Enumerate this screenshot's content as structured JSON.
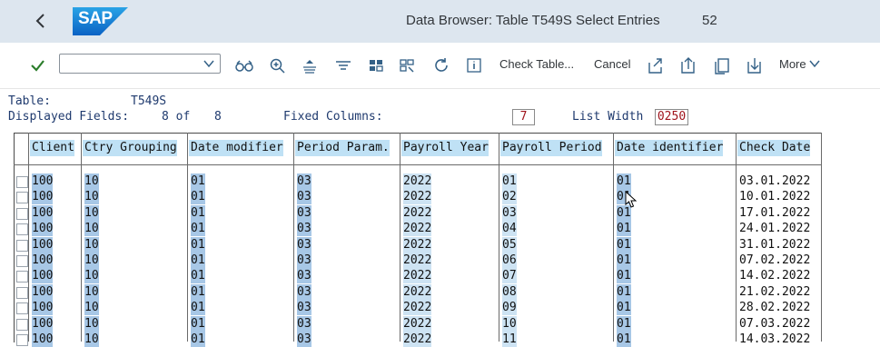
{
  "header": {
    "title": "Data Browser: Table T549S Select Entries",
    "count": "52",
    "logo": "SAP"
  },
  "toolbar": {
    "command_value": "",
    "check_table": "Check Table...",
    "cancel": "Cancel",
    "more": "More"
  },
  "info": {
    "table_label": "Table:",
    "table_name": "T549S",
    "displayed_label": "Displayed Fields:",
    "displayed_value": "8 of",
    "displayed_total": "8",
    "fixed_label": "Fixed Columns:",
    "fixed_value": "7",
    "list_width_label": "List Width",
    "list_width_value": "0250"
  },
  "columns": [
    "Client",
    "Ctry Grouping",
    "Date modifier",
    "Period Param.",
    "Payroll Year",
    "Payroll Period",
    "Date identifier",
    "Check Date"
  ],
  "rows": [
    [
      "100",
      "10",
      "01",
      "03",
      "2022",
      "01",
      "01",
      "03.01.2022"
    ],
    [
      "100",
      "10",
      "01",
      "03",
      "2022",
      "02",
      "01",
      "10.01.2022"
    ],
    [
      "100",
      "10",
      "01",
      "03",
      "2022",
      "03",
      "01",
      "17.01.2022"
    ],
    [
      "100",
      "10",
      "01",
      "03",
      "2022",
      "04",
      "01",
      "24.01.2022"
    ],
    [
      "100",
      "10",
      "01",
      "03",
      "2022",
      "05",
      "01",
      "31.01.2022"
    ],
    [
      "100",
      "10",
      "01",
      "03",
      "2022",
      "06",
      "01",
      "07.02.2022"
    ],
    [
      "100",
      "10",
      "01",
      "03",
      "2022",
      "07",
      "01",
      "14.02.2022"
    ],
    [
      "100",
      "10",
      "01",
      "03",
      "2022",
      "08",
      "01",
      "21.02.2022"
    ],
    [
      "100",
      "10",
      "01",
      "03",
      "2022",
      "09",
      "01",
      "28.02.2022"
    ],
    [
      "100",
      "10",
      "01",
      "03",
      "2022",
      "10",
      "01",
      "07.03.2022"
    ],
    [
      "100",
      "10",
      "01",
      "03",
      "2022",
      "11",
      "01",
      "14.03.2022"
    ]
  ],
  "colors": {
    "accent": "#346187",
    "brand": "#1a76c7",
    "header_bg": "#dde6ef",
    "col_highlight": "#a7c7e6",
    "warning_text": "#a0141c"
  },
  "icons": [
    "back-icon",
    "check-icon",
    "chevron-down-icon",
    "glasses-icon",
    "zoom-icon",
    "sort-asc-icon",
    "filter-icon",
    "layout-icon",
    "layout-select-icon",
    "refresh-icon",
    "info-icon",
    "export-icon",
    "upload-icon",
    "copy-icon",
    "download-icon"
  ]
}
